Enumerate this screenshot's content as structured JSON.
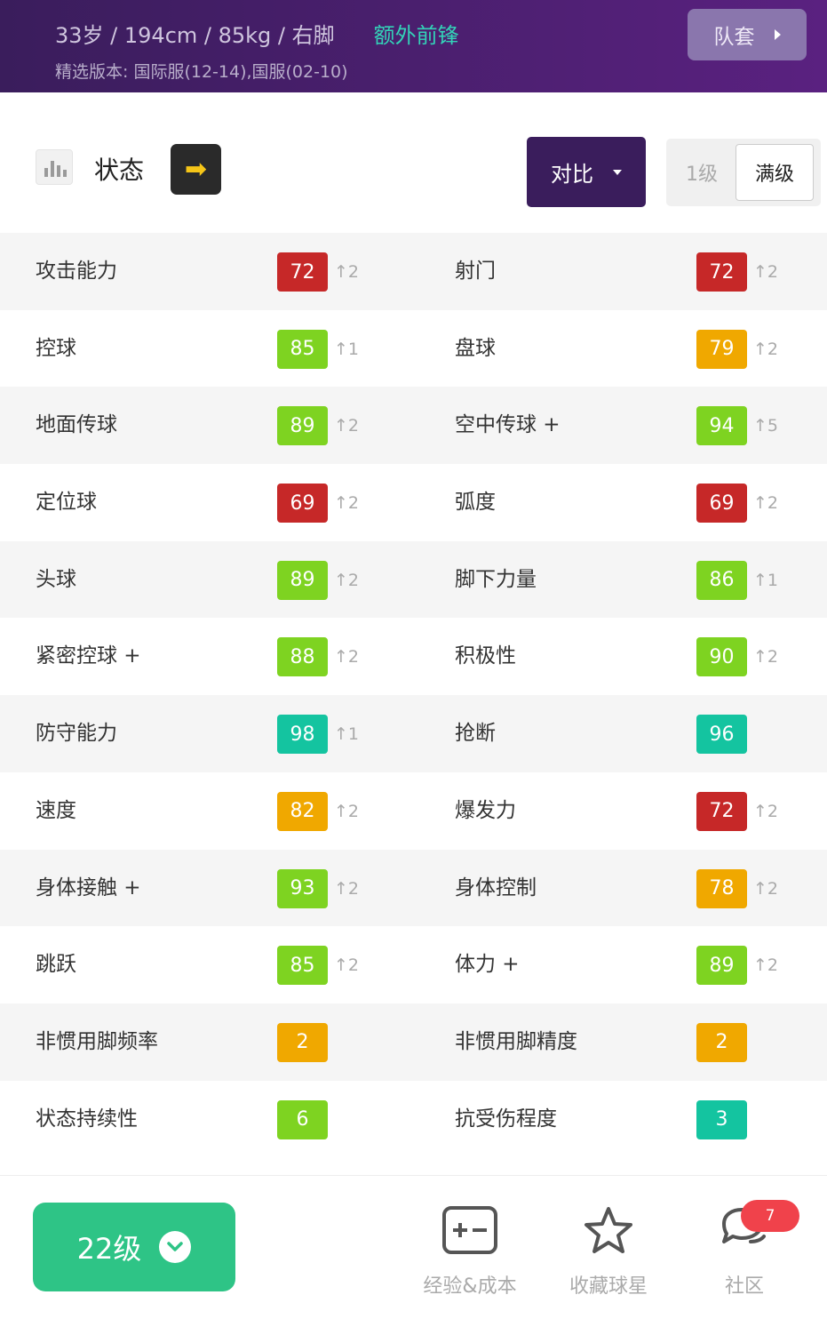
{
  "header": {
    "bio": "33岁 / 194cm / 85kg / 右脚",
    "position": "额外前锋",
    "version": "精选版本: 国际服(12-14),国服(02-10)",
    "squad_button": "队套"
  },
  "toolbar": {
    "status_label": "状态",
    "compare_label": "对比",
    "level_option_1": "1级",
    "level_option_max": "满级",
    "level_selected": "满级"
  },
  "colors": {
    "red": "#c62828",
    "lime": "#7ed321",
    "orange": "#f0a800",
    "teal": "#14c4a0",
    "purple": "#3a1d5c",
    "green_button": "#2ec486"
  },
  "stats": [
    {
      "left": {
        "name": "攻击能力",
        "value": "72",
        "color": "#c62828",
        "delta": "↑2"
      },
      "right": {
        "name": "射门",
        "value": "72",
        "color": "#c62828",
        "delta": "↑2"
      }
    },
    {
      "left": {
        "name": "控球",
        "value": "85",
        "color": "#7ed321",
        "delta": "↑1"
      },
      "right": {
        "name": "盘球",
        "value": "79",
        "color": "#f0a800",
        "delta": "↑2"
      }
    },
    {
      "left": {
        "name": "地面传球",
        "value": "89",
        "color": "#7ed321",
        "delta": "↑2"
      },
      "right": {
        "name": "空中传球 +",
        "value": "94",
        "color": "#7ed321",
        "delta": "↑5"
      }
    },
    {
      "left": {
        "name": "定位球",
        "value": "69",
        "color": "#c62828",
        "delta": "↑2"
      },
      "right": {
        "name": "弧度",
        "value": "69",
        "color": "#c62828",
        "delta": "↑2"
      }
    },
    {
      "left": {
        "name": "头球",
        "value": "89",
        "color": "#7ed321",
        "delta": "↑2"
      },
      "right": {
        "name": "脚下力量",
        "value": "86",
        "color": "#7ed321",
        "delta": "↑1"
      }
    },
    {
      "left": {
        "name": "紧密控球 +",
        "value": "88",
        "color": "#7ed321",
        "delta": "↑2"
      },
      "right": {
        "name": "积极性",
        "value": "90",
        "color": "#7ed321",
        "delta": "↑2"
      }
    },
    {
      "left": {
        "name": "防守能力",
        "value": "98",
        "color": "#14c4a0",
        "delta": "↑1"
      },
      "right": {
        "name": "抢断",
        "value": "96",
        "color": "#14c4a0",
        "delta": ""
      }
    },
    {
      "left": {
        "name": "速度",
        "value": "82",
        "color": "#f0a800",
        "delta": "↑2"
      },
      "right": {
        "name": "爆发力",
        "value": "72",
        "color": "#c62828",
        "delta": "↑2"
      }
    },
    {
      "left": {
        "name": "身体接触 +",
        "value": "93",
        "color": "#7ed321",
        "delta": "↑2"
      },
      "right": {
        "name": "身体控制",
        "value": "78",
        "color": "#f0a800",
        "delta": "↑2"
      }
    },
    {
      "left": {
        "name": "跳跃",
        "value": "85",
        "color": "#7ed321",
        "delta": "↑2"
      },
      "right": {
        "name": "体力 +",
        "value": "89",
        "color": "#7ed321",
        "delta": "↑2"
      }
    },
    {
      "left": {
        "name": "非惯用脚频率",
        "value": "2",
        "color": "#f0a800",
        "delta": ""
      },
      "right": {
        "name": "非惯用脚精度",
        "value": "2",
        "color": "#f0a800",
        "delta": ""
      }
    },
    {
      "left": {
        "name": "状态持续性",
        "value": "6",
        "color": "#7ed321",
        "delta": ""
      },
      "right": {
        "name": "抗受伤程度",
        "value": "3",
        "color": "#14c4a0",
        "delta": ""
      }
    }
  ],
  "bottom": {
    "level_button": "22级",
    "nav": [
      {
        "label": "经验&成本",
        "icon": "plus-minus-icon"
      },
      {
        "label": "收藏球星",
        "icon": "star-icon"
      },
      {
        "label": "社区",
        "icon": "chat-bubbles-icon"
      }
    ],
    "community_badge": "7"
  }
}
